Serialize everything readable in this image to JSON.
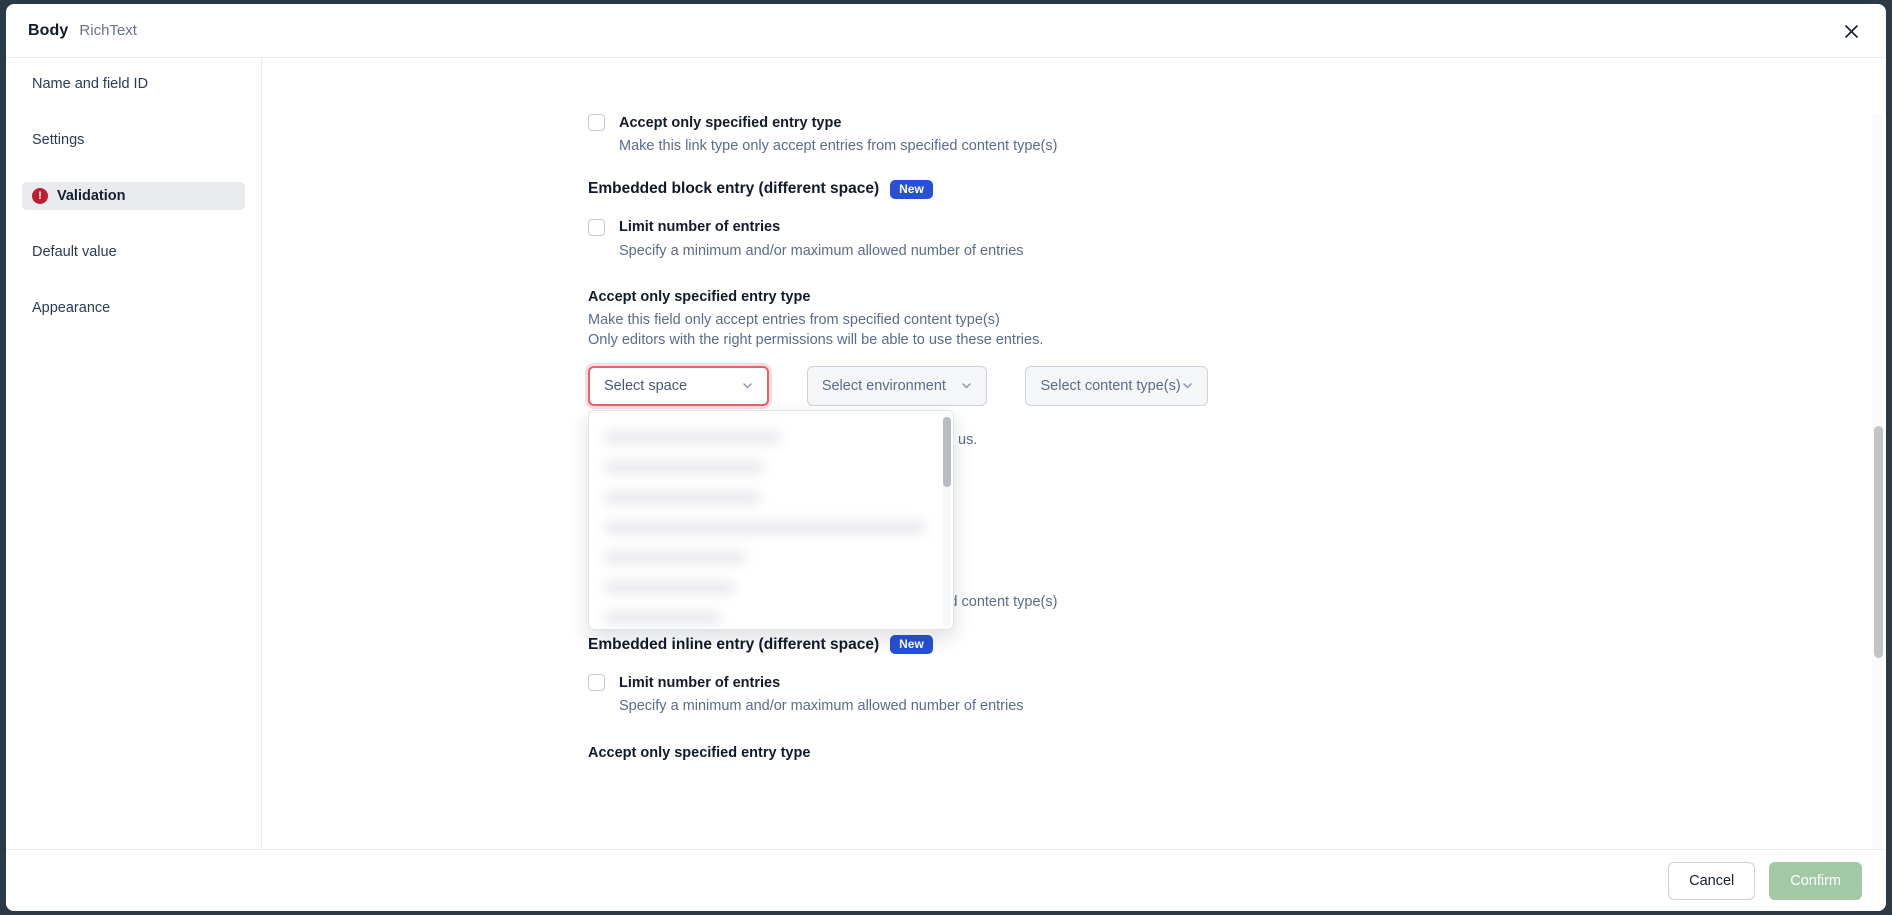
{
  "header": {
    "title": "Body",
    "subtitle": "RichText",
    "close_icon": "close-icon"
  },
  "sidebar": {
    "items": [
      {
        "label": "Name and field ID",
        "active": false,
        "error": false
      },
      {
        "label": "Settings",
        "active": false,
        "error": false
      },
      {
        "label": "Validation",
        "active": true,
        "error": true,
        "error_icon": "error-exclamation-icon"
      },
      {
        "label": "Default value",
        "active": false,
        "error": false
      },
      {
        "label": "Appearance",
        "active": false,
        "error": false
      }
    ]
  },
  "main": {
    "top_checkbox": {
      "label": "Accept only specified entry type",
      "help": "Make this link type only accept entries from specified content type(s)",
      "checked": false
    },
    "block_section": {
      "title": "Embedded block entry (different space)",
      "badge": "New",
      "limit_checkbox": {
        "label": "Limit number of entries",
        "help": "Specify a minimum and/or maximum allowed number of entries",
        "checked": false
      },
      "accept_title": "Accept only specified entry type",
      "accept_help_line1": "Make this field only accept entries from specified content type(s)",
      "accept_help_line2": "Only editors with the right permissions will be able to use these entries.",
      "selects": [
        {
          "name": "select-space",
          "value": "Select space",
          "state": "invalid",
          "chevron": "chevron-down-icon"
        },
        {
          "name": "select-environment",
          "value": "Select environment",
          "state": "disabled",
          "chevron": "chevron-down-icon"
        },
        {
          "name": "select-content-types",
          "value": "Select content type(s)",
          "state": "disabled",
          "chevron": "chevron-down-icon"
        }
      ],
      "link_help": "Make this link type only accept entries from specified content type(s)"
    },
    "space_dropdown": {
      "open": true,
      "options_redacted": true,
      "option_widths": [
        175,
        158,
        155,
        320,
        140,
        130,
        115
      ],
      "scrollbar": "vertical-scrollbar"
    },
    "peek_text": "us.",
    "inline_section": {
      "title": "Embedded inline entry (different space)",
      "badge": "New",
      "limit_checkbox": {
        "label": "Limit number of entries",
        "help": "Specify a minimum and/or maximum allowed number of entries",
        "checked": false
      },
      "accept_title": "Accept only specified entry type"
    }
  },
  "footer": {
    "cancel_label": "Cancel",
    "confirm_label": "Confirm",
    "confirm_disabled": true
  },
  "colors": {
    "accent_blue": "#2650d6",
    "error_red": "#bb2030",
    "invalid_border": "#e8616b",
    "confirm_green": "#a3c8a5",
    "text_dark": "#121b2a",
    "text_muted": "#5b6b8c"
  }
}
